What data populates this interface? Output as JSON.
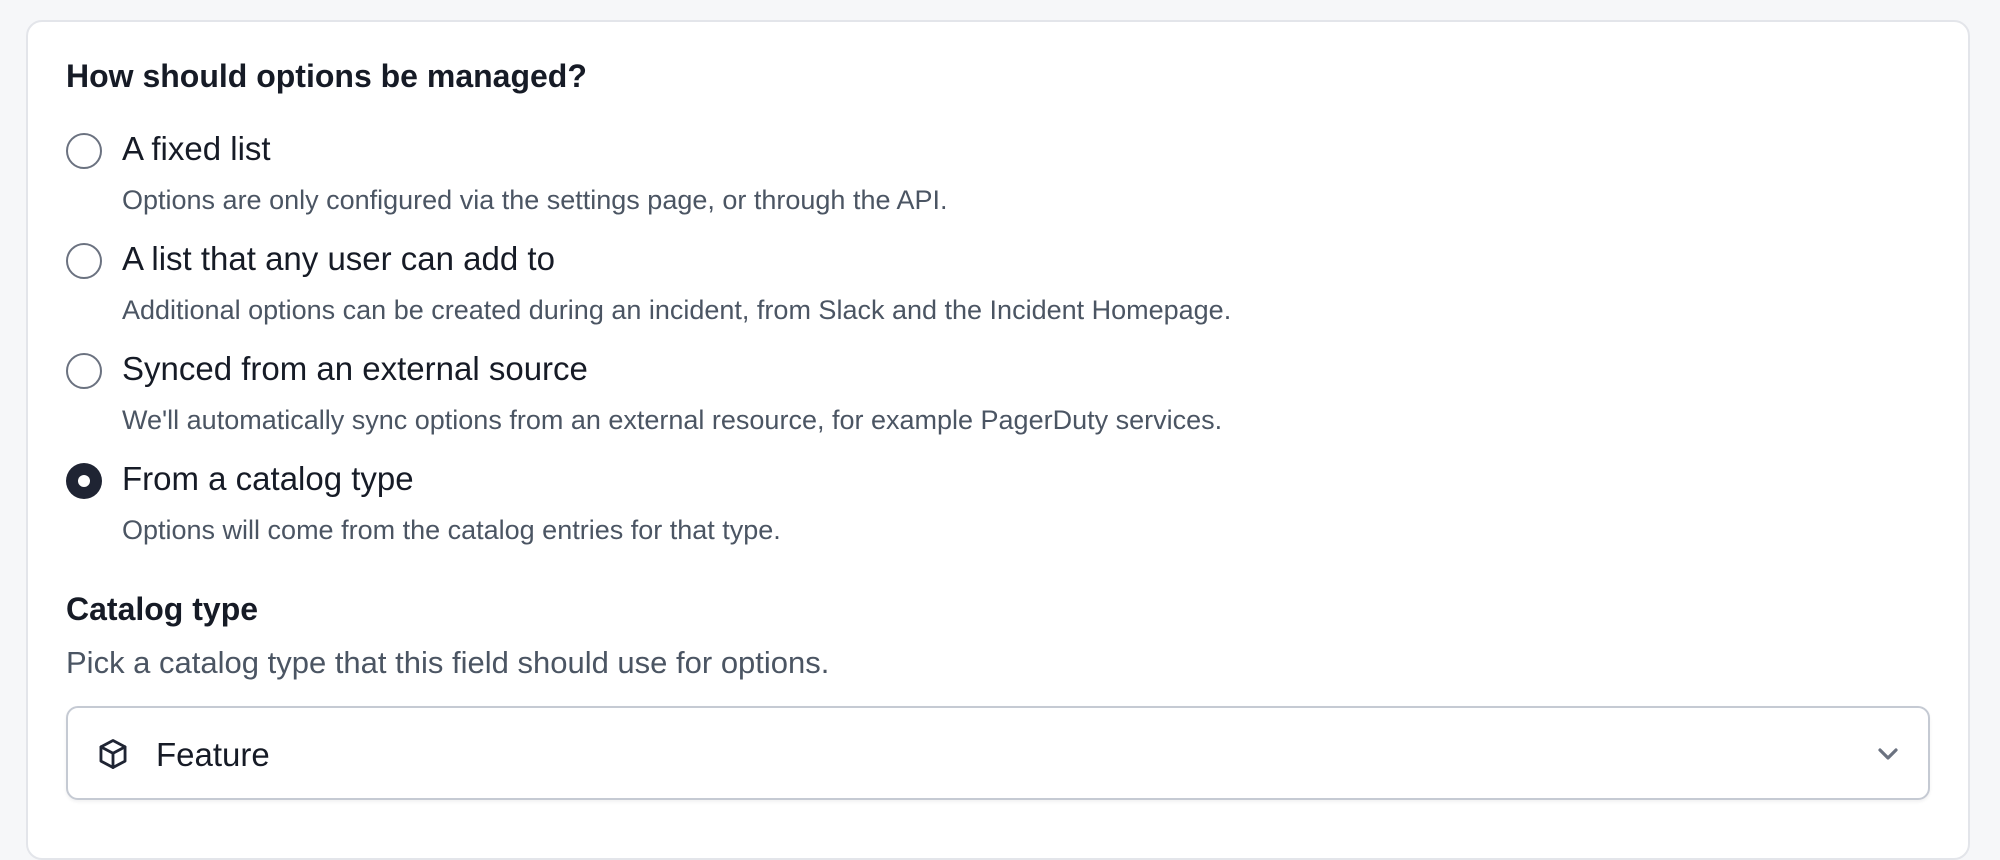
{
  "question": "How should options be managed?",
  "options": [
    {
      "label": "A fixed list",
      "description": "Options are only configured via the settings page, or through the API.",
      "checked": false
    },
    {
      "label": "A list that any user can add to",
      "description": "Additional options can be created during an incident, from Slack and the Incident Homepage.",
      "checked": false
    },
    {
      "label": "Synced from an external source",
      "description": "We'll automatically sync options from an external resource, for example PagerDuty services.",
      "checked": false
    },
    {
      "label": "From a catalog type",
      "description": "Options will come from the catalog entries for that type.",
      "checked": true
    }
  ],
  "catalog": {
    "title": "Catalog type",
    "help": "Pick a catalog type that this field should use for options.",
    "selected_value": "Feature",
    "icon": "cube-icon",
    "dropdown_icon": "chevron-down-icon"
  },
  "colors": {
    "radio_checked": "#1f2433",
    "text_primary": "#161b26",
    "text_secondary": "#4b5563",
    "card_border": "#e3e5ea",
    "page_background": "#f6f7f9"
  }
}
